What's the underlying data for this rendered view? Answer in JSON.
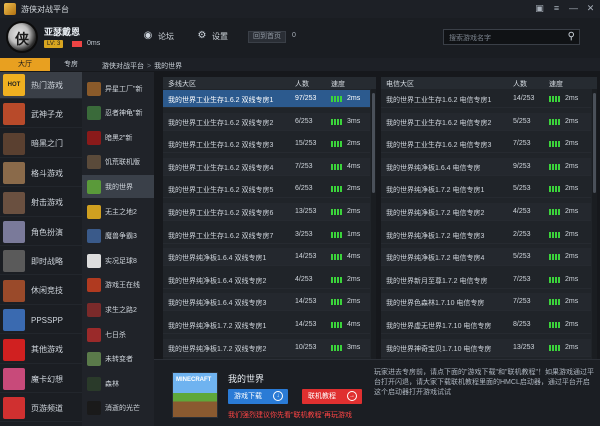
{
  "window": {
    "title": "游侠对战平台"
  },
  "user": {
    "name": "亚瑟戴恩",
    "level": "LV: 3",
    "ping": "0ms"
  },
  "header": {
    "forum_label": "论坛",
    "settings_label": "设置",
    "back_home_label": "回到首页",
    "back_home_count": "0",
    "search_placeholder": "搜索游戏名字"
  },
  "nav": {
    "tabs": [
      {
        "label": "大厅",
        "active": true
      },
      {
        "label": "专房",
        "active": false
      }
    ],
    "breadcrumb": [
      "游侠对战平台",
      "我的世界"
    ]
  },
  "categories": [
    {
      "label": "热门游戏",
      "active": true,
      "icon": "hot-icon",
      "color": "#f0b020"
    },
    {
      "label": "武神子龙",
      "active": false,
      "icon": "warrior-icon",
      "color": "#b84a2a"
    },
    {
      "label": "暗黑之门",
      "active": false,
      "icon": "dark-gate-icon",
      "color": "#5a4030"
    },
    {
      "label": "格斗游戏",
      "active": false,
      "icon": "fighting-icon",
      "color": "#8a6a4a"
    },
    {
      "label": "射击游戏",
      "active": false,
      "icon": "shooting-icon",
      "color": "#6a5040"
    },
    {
      "label": "角色扮演",
      "active": false,
      "icon": "rpg-icon",
      "color": "#7a7a9a"
    },
    {
      "label": "即时战略",
      "active": false,
      "icon": "rts-icon",
      "color": "#5a5a5a"
    },
    {
      "label": "休闲竞技",
      "active": false,
      "icon": "casual-icon",
      "color": "#9a4a2a"
    },
    {
      "label": "PPSSPP",
      "active": false,
      "icon": "psp-icon",
      "color": "#3a6ab0"
    },
    {
      "label": "其他游戏",
      "active": false,
      "icon": "other-games-icon",
      "color": "#d02020"
    },
    {
      "label": "魔卡幻想",
      "active": false,
      "icon": "magic-card-icon",
      "color": "#c84a7a"
    },
    {
      "label": "页游频道",
      "active": false,
      "icon": "web-games-icon",
      "color": "#d03030"
    }
  ],
  "games": [
    {
      "label": "异星工厂\"新",
      "icon": "factorio-icon",
      "color": "#8a5a2a",
      "active": false
    },
    {
      "label": "忍者神龟\"新",
      "icon": "ninja-turtles-icon",
      "color": "#3a6a3a",
      "active": false
    },
    {
      "label": "暗黑2\"新",
      "icon": "diablo-icon",
      "color": "#8a1a1a",
      "active": false
    },
    {
      "label": "饥荒联机版",
      "active": false,
      "icon": "dont-starve-icon",
      "color": "#5a4a3a"
    },
    {
      "label": "我的世界",
      "active": true,
      "icon": "minecraft-icon",
      "color": "#5a9a3a"
    },
    {
      "label": "无主之地2",
      "active": false,
      "icon": "borderlands-icon",
      "color": "#d0a020"
    },
    {
      "label": "魔兽争霸3",
      "active": false,
      "icon": "warcraft-icon",
      "color": "#3a5a8a"
    },
    {
      "label": "实况足球8",
      "active": false,
      "icon": "soccer-icon",
      "color": "#dddddd"
    },
    {
      "label": "游戏王在线",
      "active": false,
      "icon": "yugioh-icon",
      "color": "#b03a20"
    },
    {
      "label": "求生之路2",
      "active": false,
      "icon": "left4dead-icon",
      "color": "#7a2a2a"
    },
    {
      "label": "七日杀",
      "active": false,
      "icon": "7days-icon",
      "color": "#9a2a2a"
    },
    {
      "label": "未转变者",
      "active": false,
      "icon": "unturned-icon",
      "color": "#5a7a4a"
    },
    {
      "label": "森林",
      "active": false,
      "icon": "forest-icon",
      "color": "#2a3a2a"
    },
    {
      "label": "消逝的光芒",
      "active": false,
      "icon": "dying-light-icon",
      "color": "#1a1a1a"
    }
  ],
  "left_table": {
    "headers": {
      "name": "多线大区",
      "players": "人数",
      "speed": "速度"
    },
    "rows": [
      {
        "name": "我的世界工业生存1.6.2 双线专房1",
        "players": "97/253",
        "speed": "2ms",
        "selected": true
      },
      {
        "name": "我的世界工业生存1.6.2 双线专房2",
        "players": "6/253",
        "speed": "3ms"
      },
      {
        "name": "我的世界工业生存1.6.2 双线专房3",
        "players": "15/253",
        "speed": "2ms"
      },
      {
        "name": "我的世界工业生存1.6.2 双线专房4",
        "players": "7/253",
        "speed": "4ms"
      },
      {
        "name": "我的世界工业生存1.6.2 双线专房5",
        "players": "6/253",
        "speed": "2ms"
      },
      {
        "name": "我的世界工业生存1.6.2 双线专房6",
        "players": "13/253",
        "speed": "2ms"
      },
      {
        "name": "我的世界工业生存1.6.2 双线专房7",
        "players": "3/253",
        "speed": "1ms"
      },
      {
        "name": "我的世界纯净板1.6.4 双线专房1",
        "players": "14/253",
        "speed": "4ms"
      },
      {
        "name": "我的世界纯净板1.6.4 双线专房2",
        "players": "4/253",
        "speed": "2ms"
      },
      {
        "name": "我的世界纯净板1.6.4 双线专房3",
        "players": "14/253",
        "speed": "2ms"
      },
      {
        "name": "我的世界纯净板1.7.2 双线专房1",
        "players": "14/253",
        "speed": "4ms"
      },
      {
        "name": "我的世界纯净板1.7.2 双线专房2",
        "players": "10/253",
        "speed": "3ms"
      }
    ]
  },
  "right_table": {
    "headers": {
      "name": "电信大区",
      "players": "人数",
      "speed": "速度"
    },
    "rows": [
      {
        "name": "我的世界工业生存1.6.2 电信专房1",
        "players": "14/253",
        "speed": "2ms"
      },
      {
        "name": "我的世界工业生存1.6.2 电信专房2",
        "players": "5/253",
        "speed": "2ms"
      },
      {
        "name": "我的世界工业生存1.6.2 电信专房3",
        "players": "7/253",
        "speed": "2ms"
      },
      {
        "name": "我的世界纯净板1.6.4 电信专房",
        "players": "9/253",
        "speed": "2ms"
      },
      {
        "name": "我的世界纯净板1.7.2 电信专房1",
        "players": "5/253",
        "speed": "2ms"
      },
      {
        "name": "我的世界纯净板1.7.2 电信专房2",
        "players": "4/253",
        "speed": "2ms"
      },
      {
        "name": "我的世界纯净板1.7.2 电信专房3",
        "players": "2/253",
        "speed": "2ms"
      },
      {
        "name": "我的世界纯净板1.7.2 电信专房4",
        "players": "5/253",
        "speed": "2ms"
      },
      {
        "name": "我的世界新月至尊1.7.2 电信专房",
        "players": "7/253",
        "speed": "2ms"
      },
      {
        "name": "我的世界色森林1.7.10 电信专房",
        "players": "7/253",
        "speed": "2ms"
      },
      {
        "name": "我的世界虚无世界1.7.10 电信专房",
        "players": "8/253",
        "speed": "2ms"
      },
      {
        "name": "我的世界神奇宝贝1.7.10 电信专房",
        "players": "13/253",
        "speed": "2ms"
      }
    ]
  },
  "info": {
    "game_title": "我的世界",
    "thumbnail_text": "MINECRAFT",
    "download_label": "游戏下载",
    "tutorial_label": "联机教程",
    "warning": "我们强烈建议你先看\"联机教程\"再玩游戏",
    "description": "玩家进去专房前，请点下面的\"游戏下载\"和\"联机教程\"！如果游戏通过平台打开闪退，请大家下载联机教程里面的HMCL启动器，通过平台开启这个启动器打开游戏试试"
  },
  "colors": {
    "accent": "#e8a020",
    "selected_row": "#2c5a8e",
    "signal": "#3bd43b",
    "download": "#2a7bd6",
    "tutorial": "#e03030",
    "warning": "#ff4444"
  }
}
